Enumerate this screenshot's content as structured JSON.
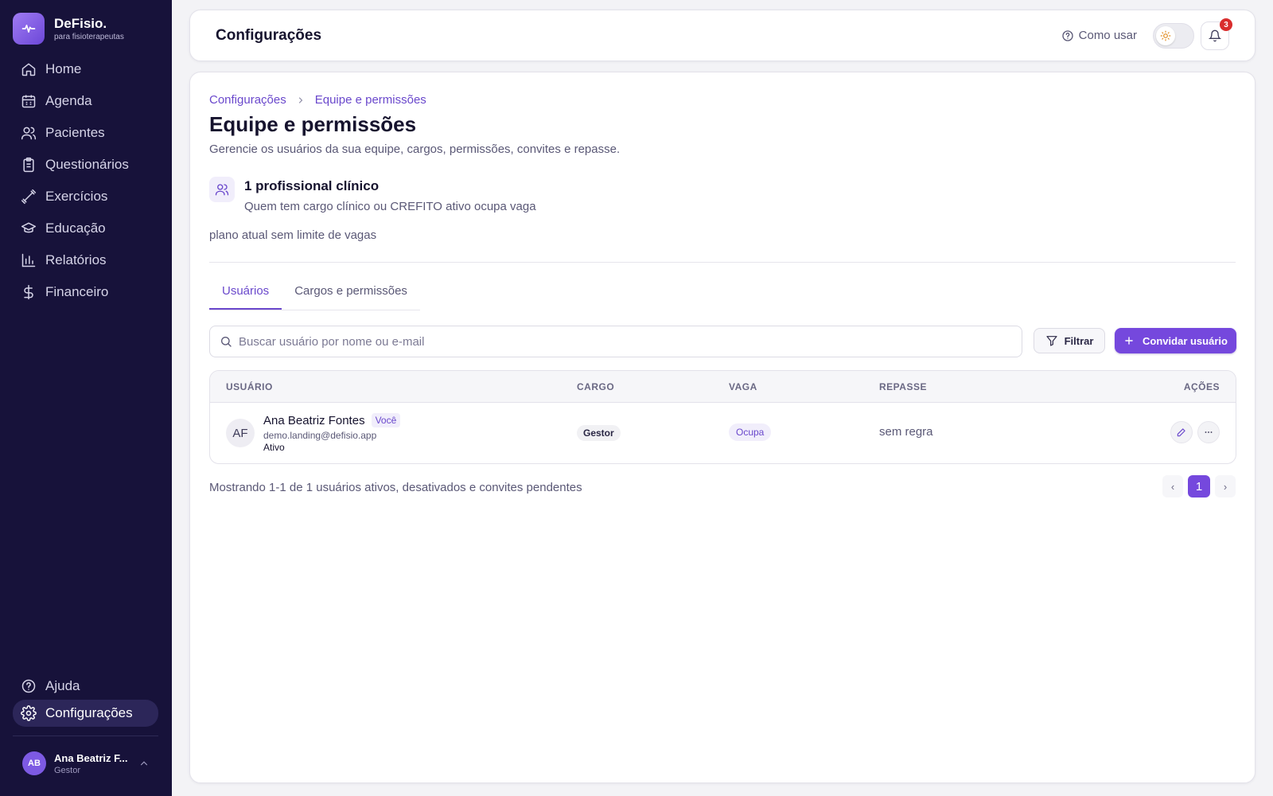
{
  "brand": {
    "name": "DeFisio.",
    "tagline": "para fisioterapeutas"
  },
  "nav": {
    "items": [
      {
        "label": "Home",
        "icon": "home-icon"
      },
      {
        "label": "Agenda",
        "icon": "calendar-icon"
      },
      {
        "label": "Pacientes",
        "icon": "users-icon"
      },
      {
        "label": "Questionários",
        "icon": "clipboard-icon"
      },
      {
        "label": "Exercícios",
        "icon": "dumbbell-icon"
      },
      {
        "label": "Educação",
        "icon": "graduation-cap-icon"
      },
      {
        "label": "Relatórios",
        "icon": "bar-chart-icon"
      },
      {
        "label": "Financeiro",
        "icon": "dollar-icon"
      }
    ],
    "bottom": [
      {
        "label": "Ajuda",
        "icon": "help-circle-icon"
      },
      {
        "label": "Configurações",
        "icon": "gear-icon",
        "active": true
      }
    ]
  },
  "user": {
    "initials": "AB",
    "name": "Ana Beatriz F...",
    "role": "Gestor"
  },
  "header": {
    "title": "Configurações",
    "howto": "Como usar",
    "notifications": "3"
  },
  "breadcrumb": {
    "root": "Configurações",
    "current": "Equipe e permissões"
  },
  "page": {
    "title": "Equipe e permissões",
    "description": "Gerencie os usuários da sua equipe, cargos, permissões, convites e repasse."
  },
  "seats": {
    "title": "1 profissional clínico",
    "subtitle": "Quem tem cargo clínico ou CREFITO ativo ocupa vaga",
    "plan_note": "plano atual sem limite de vagas"
  },
  "tabs": [
    {
      "label": "Usuários",
      "active": true
    },
    {
      "label": "Cargos e permissões",
      "active": false
    }
  ],
  "search": {
    "placeholder": "Buscar usuário por nome ou e-mail",
    "value": ""
  },
  "toolbar": {
    "filter_label": "Filtrar",
    "invite_label": "Convidar usuário"
  },
  "table": {
    "columns": [
      "USUÁRIO",
      "CARGO",
      "VAGA",
      "REPASSE",
      "AÇÕES"
    ],
    "rows": [
      {
        "initials": "AF",
        "name": "Ana Beatriz Fontes",
        "you_badge": "Você",
        "email": "demo.landing@defisio.app",
        "status": "Ativo",
        "role": "Gestor",
        "seat": "Ocupa",
        "repasse": "sem regra"
      }
    ]
  },
  "footer": {
    "summary": "Mostrando 1-1 de 1 usuários ativos, desativados e convites pendentes"
  },
  "pagination": {
    "prev": "‹",
    "current": "1",
    "next": "›"
  },
  "colors": {
    "sidebar": "#17123a",
    "accent": "#7548dd",
    "badge": "#d92d2d"
  }
}
